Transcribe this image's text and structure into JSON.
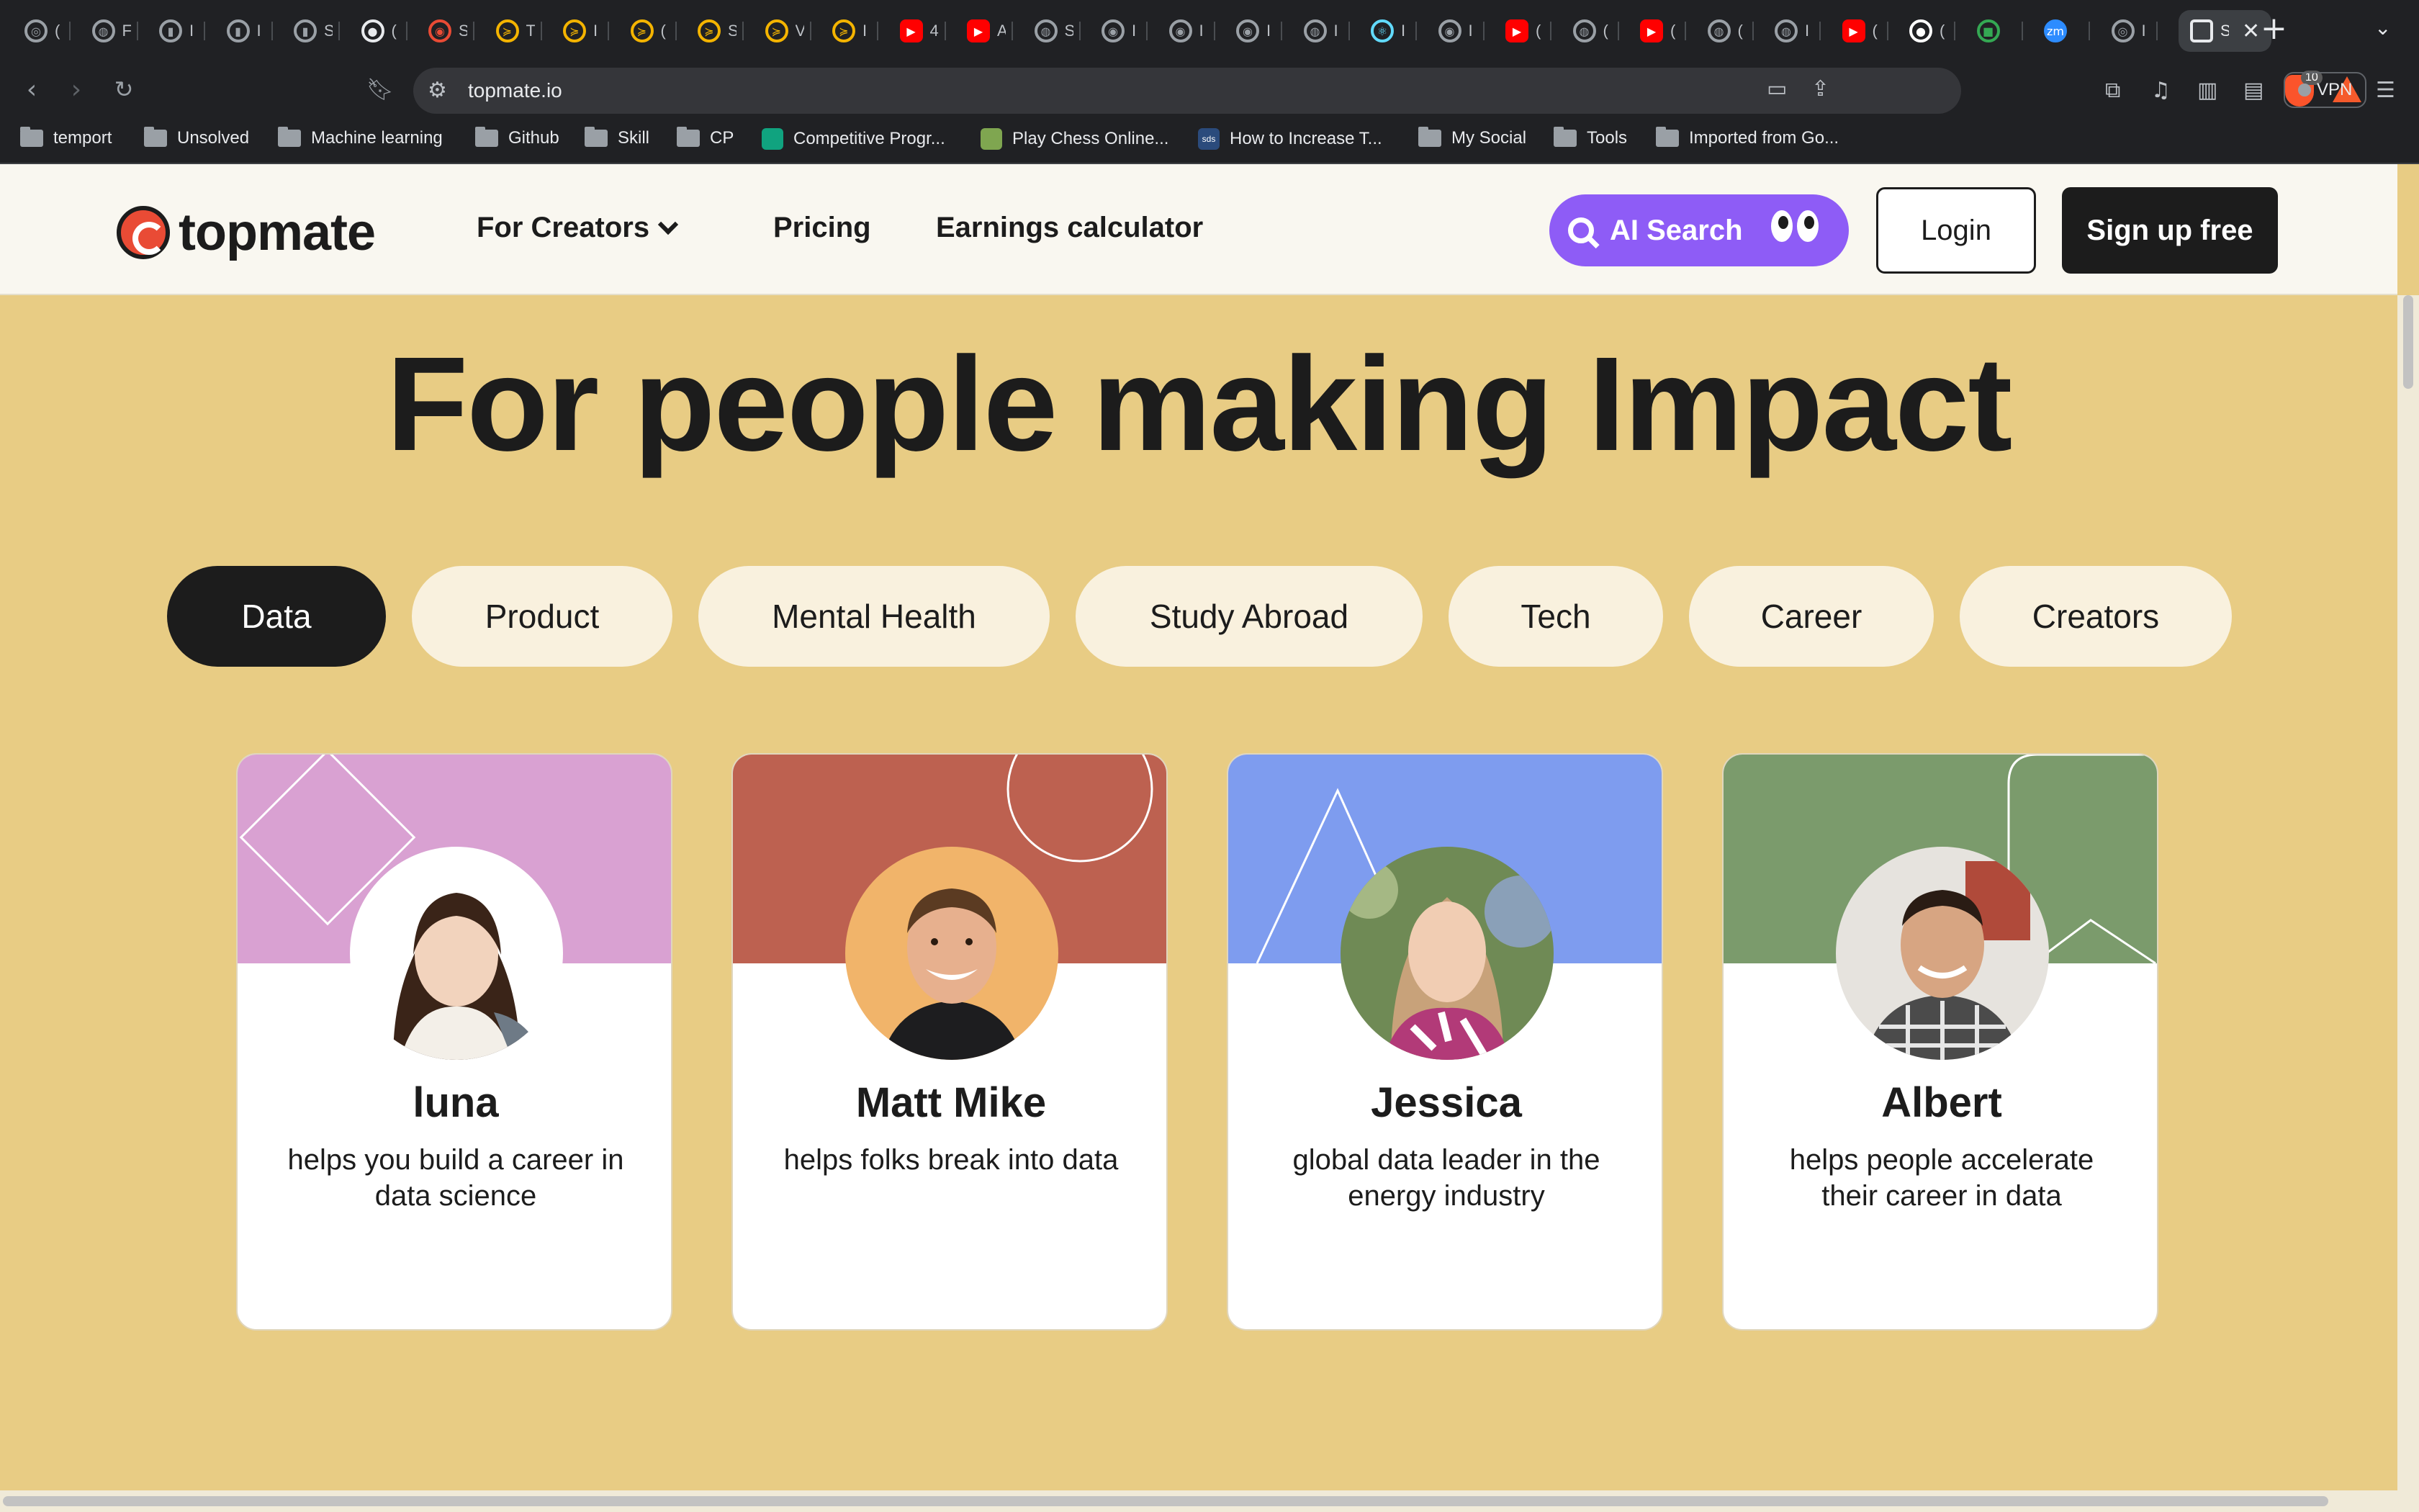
{
  "browser": {
    "tabs": [
      {
        "icon": "chatgpt-icon",
        "title": "(",
        "color": "#9aa0a6"
      },
      {
        "icon": "globe-icon",
        "title": "F",
        "color": "#9aa0a6"
      },
      {
        "icon": "chart-icon",
        "title": "I",
        "color": "#9aa0a6"
      },
      {
        "icon": "chart-icon",
        "title": "I",
        "color": "#9aa0a6"
      },
      {
        "icon": "chart-icon",
        "title": "S",
        "color": "#9aa0a6"
      },
      {
        "icon": "avatar-icon",
        "title": "(",
        "color": "#e8eaed"
      },
      {
        "icon": "record-icon",
        "title": "S",
        "color": "#e94b35"
      },
      {
        "icon": "arrow-icon",
        "title": "T",
        "color": "#f4b400"
      },
      {
        "icon": "arrow-icon",
        "title": "I",
        "color": "#f4b400"
      },
      {
        "icon": "arrow-icon",
        "title": "(",
        "color": "#f4b400"
      },
      {
        "icon": "arrow-icon",
        "title": "S",
        "color": "#f4b400"
      },
      {
        "icon": "arrow-icon",
        "title": "V",
        "color": "#f4b400"
      },
      {
        "icon": "arrow-icon",
        "title": "I",
        "color": "#f4b400"
      },
      {
        "icon": "youtube-icon",
        "title": "4",
        "color": "#ff0000"
      },
      {
        "icon": "youtube-icon",
        "title": "A",
        "color": "#ff0000"
      },
      {
        "icon": "globe-icon",
        "title": "S",
        "color": "#9aa0a6"
      },
      {
        "icon": "record-icon",
        "title": "I",
        "color": "#9aa0a6"
      },
      {
        "icon": "record-icon",
        "title": "I",
        "color": "#9aa0a6"
      },
      {
        "icon": "record-icon",
        "title": "I",
        "color": "#9aa0a6"
      },
      {
        "icon": "globe-icon",
        "title": "I",
        "color": "#9aa0a6"
      },
      {
        "icon": "react-icon",
        "title": "I",
        "color": "#61dafb"
      },
      {
        "icon": "record-icon",
        "title": "I",
        "color": "#9aa0a6"
      },
      {
        "icon": "youtube-icon",
        "title": "(",
        "color": "#ff0000"
      },
      {
        "icon": "globe-icon",
        "title": "(",
        "color": "#9aa0a6"
      },
      {
        "icon": "youtube-icon",
        "title": "(",
        "color": "#ff0000"
      },
      {
        "icon": "globe-icon",
        "title": "(",
        "color": "#9aa0a6"
      },
      {
        "icon": "globe-icon",
        "title": "I",
        "color": "#9aa0a6"
      },
      {
        "icon": "youtube-icon",
        "title": "(",
        "color": "#ff0000"
      },
      {
        "icon": "github-icon",
        "title": "(",
        "color": "#ffffff"
      },
      {
        "icon": "meet-icon",
        "title": "",
        "color": "#34a853"
      },
      {
        "icon": "zm-icon",
        "title": "",
        "color": "#2d8cff"
      },
      {
        "icon": "chatgpt-icon",
        "title": "I",
        "color": "#9aa0a6"
      }
    ],
    "active_tab": {
      "icon": "topmate-tab-icon",
      "title": "S"
    },
    "url": "topmate.io",
    "vpn_label": "VPN",
    "brave_badge": "10",
    "bookmarks": [
      {
        "label": "temport",
        "type": "folder"
      },
      {
        "label": "Unsolved",
        "type": "folder"
      },
      {
        "label": "Machine learning",
        "type": "folder"
      },
      {
        "label": "Github",
        "type": "folder"
      },
      {
        "label": "Skill",
        "type": "folder"
      },
      {
        "label": "CP",
        "type": "folder"
      },
      {
        "label": "Competitive Progr...",
        "type": "site",
        "color": "#10a37f"
      },
      {
        "label": "Play Chess Online...",
        "type": "site",
        "color": "#7fa650"
      },
      {
        "label": "How to Increase T...",
        "type": "site",
        "color": "#2b4b7c",
        "badge": "sds"
      },
      {
        "label": "My Social",
        "type": "folder"
      },
      {
        "label": "Tools",
        "type": "folder"
      },
      {
        "label": "Imported from Go...",
        "type": "folder"
      }
    ]
  },
  "header": {
    "logo_text": "topmate",
    "nav": {
      "for_creators": "For Creators",
      "pricing": "Pricing",
      "earnings": "Earnings calculator"
    },
    "ai_search": "AI Search",
    "login": "Login",
    "signup": "Sign up free"
  },
  "hero": {
    "title_regular": "For people ",
    "title_bold": "making Impact"
  },
  "categories": [
    {
      "label": "Data",
      "active": true
    },
    {
      "label": "Product",
      "active": false
    },
    {
      "label": "Mental Health",
      "active": false
    },
    {
      "label": "Study Abroad",
      "active": false
    },
    {
      "label": "Tech",
      "active": false
    },
    {
      "label": "Career",
      "active": false
    },
    {
      "label": "Creators",
      "active": false
    }
  ],
  "creators": [
    {
      "name": "luna",
      "description": "helps you build a career in data science",
      "bg_color": "#d9a1d2",
      "avatar_bg": "#ffffff"
    },
    {
      "name": "Matt Mike",
      "description": "helps folks break into data",
      "bg_color": "#bd6150",
      "avatar_bg": "#f1b46a"
    },
    {
      "name": "Jessica",
      "description": "global data leader in the energy industry",
      "bg_color": "#7e9cef",
      "avatar_bg": "#6f8a55"
    },
    {
      "name": "Albert",
      "description": "helps people accelerate their career in data",
      "bg_color": "#7b9b6c",
      "avatar_bg": "#e6e3de"
    }
  ],
  "colors": {
    "page_bg": "#e8cc84",
    "brand_red": "#e94b35",
    "ai_purple": "#8e5cf6",
    "dark": "#1c1c1c",
    "chip_bg": "#f9f1de"
  }
}
